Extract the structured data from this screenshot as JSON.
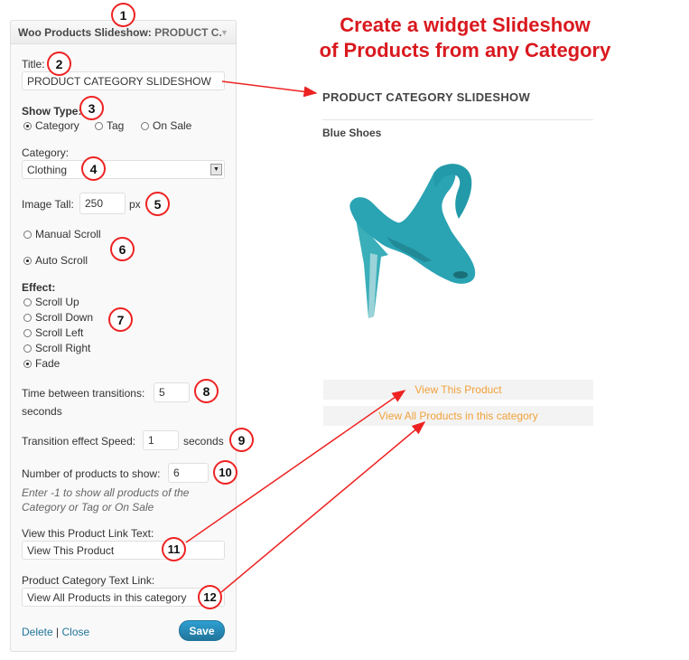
{
  "headline": {
    "line1": "Create a widget Slideshow",
    "line2": "of Products from any Category"
  },
  "widget": {
    "title_main": "Woo Products Slideshow:",
    "title_sub": "PRODUCT C.",
    "title_label": "Title:",
    "title_value": "PRODUCT CATEGORY SLIDESHOW",
    "show_type_label": "Show Type:",
    "show_type_options": [
      "Category",
      "Tag",
      "On Sale"
    ],
    "category_label": "Category:",
    "category_value": "Clothing",
    "image_tall_label": "Image Tall:",
    "image_tall_value": "250",
    "image_tall_unit": "px",
    "scroll_options": [
      "Manual Scroll",
      "Auto Scroll"
    ],
    "effect_label": "Effect:",
    "effect_options": [
      "Scroll Up",
      "Scroll Down",
      "Scroll Left",
      "Scroll Right",
      "Fade"
    ],
    "time_label": "Time between transitions:",
    "time_value": "5",
    "time_unit": "seconds",
    "speed_label": "Transition effect Speed:",
    "speed_value": "1",
    "speed_unit": "seconds",
    "count_label": "Number of products to show:",
    "count_value": "6",
    "count_help_1": "Enter -1 to show all products of the",
    "count_help_2": "Category or Tag or On Sale",
    "view_link_label": "View this Product Link Text:",
    "view_link_value": "View This Product",
    "cat_link_label": "Product Category Text Link:",
    "cat_link_value": "View All Products in this category",
    "delete_label": "Delete",
    "separator": "|",
    "close_label": "Close",
    "save_label": "Save"
  },
  "markers": [
    "1",
    "2",
    "3",
    "4",
    "5",
    "6",
    "7",
    "8",
    "9",
    "10",
    "11",
    "12"
  ],
  "preview": {
    "title": "PRODUCT CATEGORY SLIDESHOW",
    "product_name": "Blue Shoes",
    "view_product": "View This Product",
    "view_all": "View All Products in this category"
  },
  "colors": {
    "headline": "#d9191f",
    "marker_border": "#ee2222",
    "link": "#21759b",
    "product_link": "#f2a13a",
    "shoe": "#2aa3b3"
  }
}
